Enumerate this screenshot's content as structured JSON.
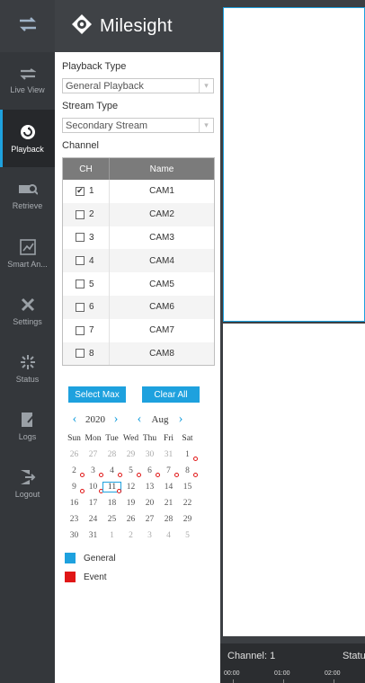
{
  "brand": {
    "name": "Milesight"
  },
  "nav": [
    {
      "label": "",
      "icon": "swap-arrows-icon"
    },
    {
      "label": "Live View",
      "icon": "live-view-icon"
    },
    {
      "label": "Playback",
      "icon": "playback-icon",
      "active": true
    },
    {
      "label": "Retrieve",
      "icon": "retrieve-icon"
    },
    {
      "label": "Smart An...",
      "icon": "smart-analytics-icon"
    },
    {
      "label": "Settings",
      "icon": "settings-icon"
    },
    {
      "label": "Status",
      "icon": "status-icon"
    },
    {
      "label": "Logs",
      "icon": "logs-icon"
    },
    {
      "label": "Logout",
      "icon": "logout-icon"
    }
  ],
  "panel": {
    "playback_type_label": "Playback Type",
    "playback_type_value": "General Playback",
    "stream_type_label": "Stream Type",
    "stream_type_value": "Secondary Stream",
    "channel_label": "Channel",
    "table": {
      "col_ch": "CH",
      "col_name": "Name",
      "rows": [
        {
          "ch": "1",
          "name": "CAM1",
          "checked": true
        },
        {
          "ch": "2",
          "name": "CAM2",
          "checked": false
        },
        {
          "ch": "3",
          "name": "CAM3",
          "checked": false
        },
        {
          "ch": "4",
          "name": "CAM4",
          "checked": false
        },
        {
          "ch": "5",
          "name": "CAM5",
          "checked": false
        },
        {
          "ch": "6",
          "name": "CAM6",
          "checked": false
        },
        {
          "ch": "7",
          "name": "CAM7",
          "checked": false
        },
        {
          "ch": "8",
          "name": "CAM8",
          "checked": false
        }
      ]
    },
    "select_max": "Select Max",
    "clear_all": "Clear All"
  },
  "calendar": {
    "year": "2020",
    "month": "Aug",
    "weekdays": [
      "Sun",
      "Mon",
      "Tue",
      "Wed",
      "Thu",
      "Fri",
      "Sat"
    ],
    "weeks": [
      [
        {
          "d": "26",
          "o": true
        },
        {
          "d": "27",
          "o": true
        },
        {
          "d": "28",
          "o": true
        },
        {
          "d": "29",
          "o": true
        },
        {
          "d": "30",
          "o": true
        },
        {
          "d": "31",
          "o": true
        },
        {
          "d": "1",
          "r": true
        }
      ],
      [
        {
          "d": "2",
          "r": true
        },
        {
          "d": "3",
          "r": true
        },
        {
          "d": "4",
          "r": true
        },
        {
          "d": "5",
          "r": true
        },
        {
          "d": "6",
          "r": true
        },
        {
          "d": "7",
          "r": true
        },
        {
          "d": "8",
          "r": true
        }
      ],
      [
        {
          "d": "9",
          "r": true
        },
        {
          "d": "10",
          "r": true
        },
        {
          "d": "11",
          "r": true,
          "s": true
        },
        {
          "d": "12"
        },
        {
          "d": "13"
        },
        {
          "d": "14"
        },
        {
          "d": "15"
        }
      ],
      [
        {
          "d": "16"
        },
        {
          "d": "17"
        },
        {
          "d": "18"
        },
        {
          "d": "19"
        },
        {
          "d": "20"
        },
        {
          "d": "21"
        },
        {
          "d": "22"
        }
      ],
      [
        {
          "d": "23"
        },
        {
          "d": "24"
        },
        {
          "d": "25"
        },
        {
          "d": "26"
        },
        {
          "d": "27"
        },
        {
          "d": "28"
        },
        {
          "d": "29"
        }
      ],
      [
        {
          "d": "30"
        },
        {
          "d": "31"
        },
        {
          "d": "1",
          "o": true
        },
        {
          "d": "2",
          "o": true
        },
        {
          "d": "3",
          "o": true
        },
        {
          "d": "4",
          "o": true
        },
        {
          "d": "5",
          "o": true
        }
      ]
    ]
  },
  "legend": [
    {
      "label": "General",
      "color": "#1ea1de"
    },
    {
      "label": "Event",
      "color": "#e01616"
    }
  ],
  "status_bar": {
    "channel": "Channel: 1",
    "status": "Statu",
    "ticks": [
      "00:00",
      "01:00",
      "02:00"
    ]
  },
  "colors": {
    "accent": "#1ea1de",
    "event": "#e01616"
  }
}
